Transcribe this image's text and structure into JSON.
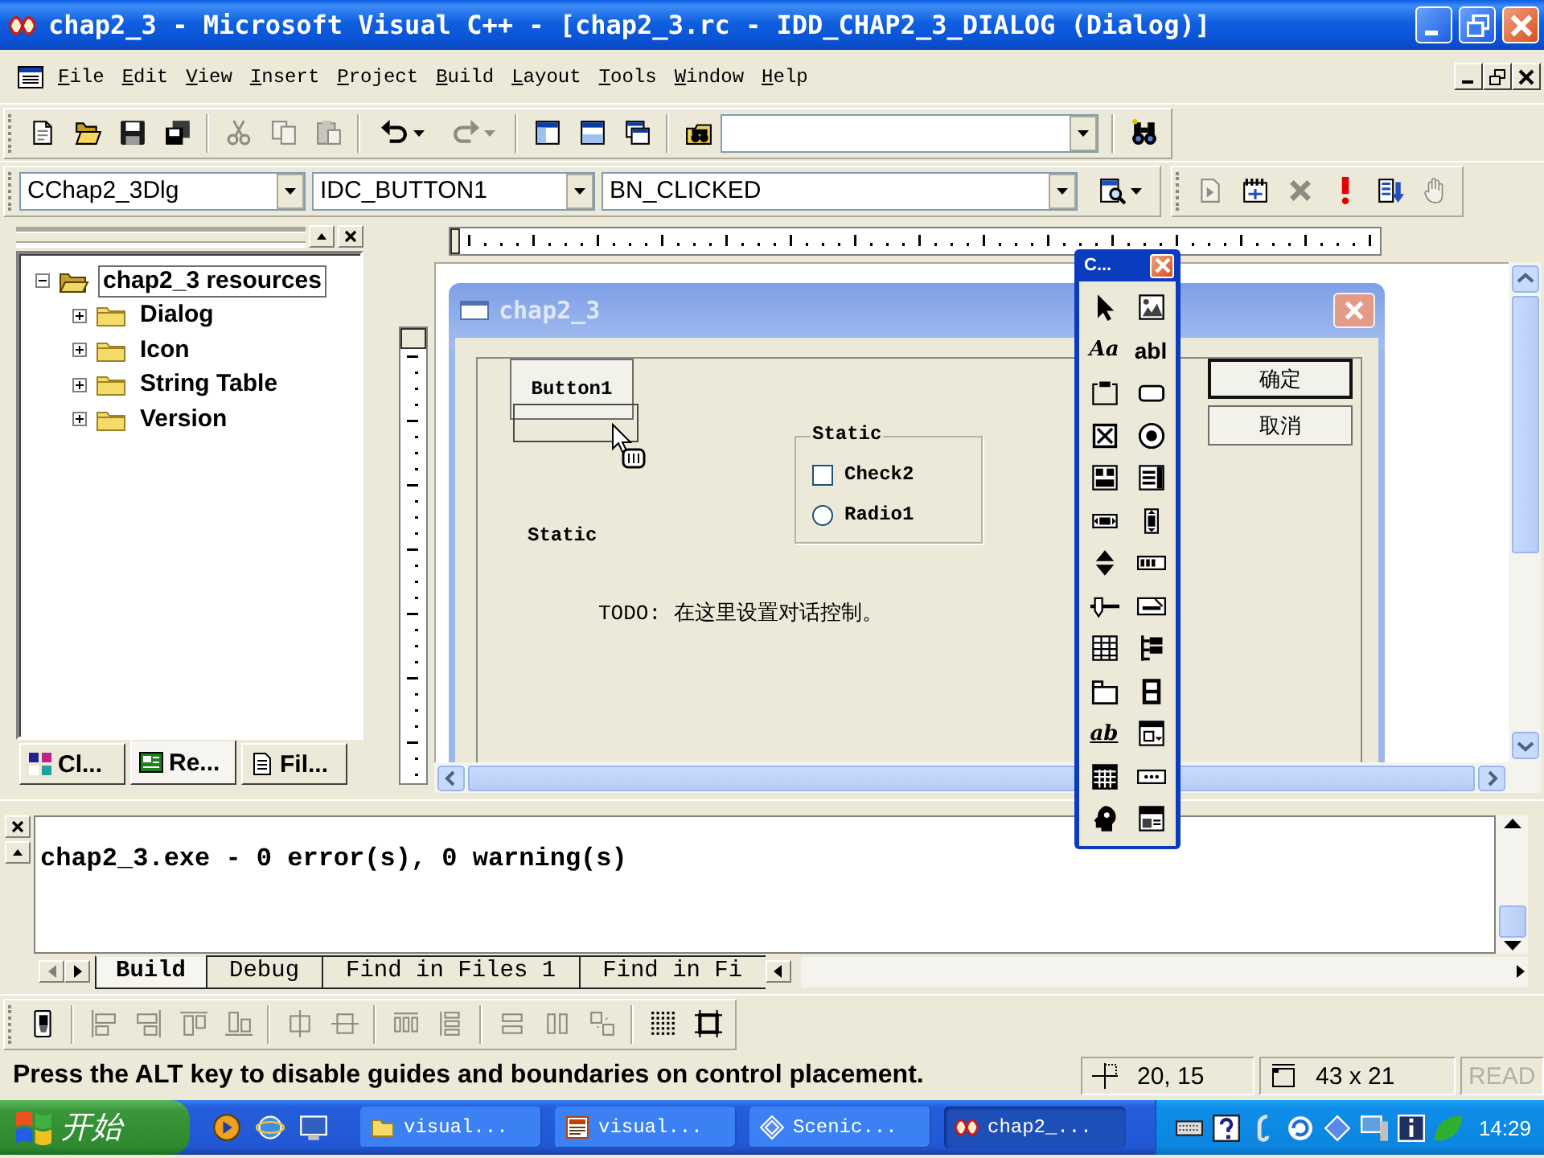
{
  "window": {
    "title": "chap2_3 - Microsoft Visual C++ - [chap2_3.rc - IDD_CHAP2_3_DIALOG (Dialog)]"
  },
  "menu_bar": {
    "items": [
      "File",
      "Edit",
      "View",
      "Insert",
      "Project",
      "Build",
      "Layout",
      "Tools",
      "Window",
      "Help"
    ]
  },
  "standard_toolbar": {
    "groups": [
      [
        {
          "kind": "new",
          "disabled": false
        },
        {
          "kind": "open",
          "disabled": false
        },
        {
          "kind": "save",
          "disabled": false
        },
        {
          "kind": "save_all",
          "disabled": false
        }
      ],
      [
        {
          "kind": "cut",
          "disabled": true
        },
        {
          "kind": "copy",
          "disabled": true
        },
        {
          "kind": "paste",
          "disabled": true
        }
      ],
      [
        {
          "kind": "undo",
          "disabled": false
        },
        {
          "kind": "redo",
          "disabled": true
        }
      ],
      [
        {
          "kind": "workspace",
          "disabled": false
        },
        {
          "kind": "output",
          "disabled": false
        },
        {
          "kind": "windows",
          "disabled": false
        }
      ],
      [
        {
          "kind": "find_in_files",
          "disabled": false
        },
        {
          "kind": "combo",
          "disabled": false
        }
      ],
      [
        {
          "kind": "find",
          "disabled": false
        }
      ]
    ]
  },
  "wizard_bar": {
    "class_combo": "CChap2_3Dlg",
    "filter_combo": "IDC_BUTTON1",
    "member_combo": "BN_CLICKED",
    "buttons": [
      {
        "kind": "wizard_action",
        "disabled": false
      }
    ]
  },
  "build_toolbar": {
    "buttons": [
      {
        "kind": "compile",
        "disabled": true
      },
      {
        "kind": "build",
        "disabled": false
      },
      {
        "kind": "stop_build",
        "disabled": true
      },
      {
        "kind": "execute",
        "disabled": false
      },
      {
        "kind": "go",
        "disabled": false
      },
      {
        "kind": "breakpoint",
        "disabled": true
      }
    ]
  },
  "workspace": {
    "tree": [
      {
        "label": "chap2_3 resources",
        "expanded": true,
        "selected": true,
        "children": [
          {
            "label": "Dialog",
            "expanded": false,
            "selected": false
          },
          {
            "label": "Icon",
            "expanded": false,
            "selected": false
          },
          {
            "label": "String Table",
            "expanded": false,
            "selected": false
          },
          {
            "label": "Version",
            "expanded": false,
            "selected": false
          }
        ]
      }
    ],
    "tabs": [
      {
        "label": "Cl...",
        "selected": false
      },
      {
        "label": "Re...",
        "selected": true
      },
      {
        "label": "Fil...",
        "selected": false
      }
    ]
  },
  "dialog_editor": {
    "dialog": {
      "title": "chap2_3",
      "controls": [
        {
          "kind": "button",
          "label": "Button1",
          "default": false,
          "selected": true
        },
        {
          "kind": "group_box",
          "label": "Static",
          "selected": false
        },
        {
          "kind": "check_box",
          "label": "Check2",
          "checked": false,
          "selected": false
        },
        {
          "kind": "radio",
          "label": "Radio1",
          "checked": false,
          "selected": false
        },
        {
          "kind": "static",
          "label": "Static",
          "selected": false
        },
        {
          "kind": "static",
          "label": "TODO: 在这里设置对话控制。",
          "selected": false
        },
        {
          "kind": "button",
          "label": "确定",
          "default": true,
          "selected": false
        },
        {
          "kind": "button",
          "label": "取消",
          "default": false,
          "selected": false
        }
      ]
    }
  },
  "controls_toolbox": {
    "title": "C...",
    "tools": [
      {
        "kind": "pointer"
      },
      {
        "kind": "picture"
      },
      {
        "kind": "static_text",
        "glyph": "Aa"
      },
      {
        "kind": "edit",
        "glyph": "abl"
      },
      {
        "kind": "group_box"
      },
      {
        "kind": "button"
      },
      {
        "kind": "check_box"
      },
      {
        "kind": "radio"
      },
      {
        "kind": "combo_box"
      },
      {
        "kind": "list_box"
      },
      {
        "kind": "h_scroll"
      },
      {
        "kind": "v_scroll"
      },
      {
        "kind": "spin"
      },
      {
        "kind": "progress"
      },
      {
        "kind": "slider"
      },
      {
        "kind": "hotkey"
      },
      {
        "kind": "list_control"
      },
      {
        "kind": "tree_control"
      },
      {
        "kind": "tab_control"
      },
      {
        "kind": "animate"
      },
      {
        "kind": "rich_edit",
        "glyph": "ab"
      },
      {
        "kind": "date_time"
      },
      {
        "kind": "month_calendar"
      },
      {
        "kind": "ip_address"
      },
      {
        "kind": "custom"
      },
      {
        "kind": "extended_combo"
      }
    ]
  },
  "output": {
    "lines": [
      "chap2_3.exe - 0 error(s), 0 warning(s)"
    ],
    "tabs": [
      {
        "label": "Build",
        "selected": true
      },
      {
        "label": "Debug",
        "selected": false
      },
      {
        "label": "Find in Files 1",
        "selected": false
      },
      {
        "label": "Find in Fi",
        "selected": false
      }
    ]
  },
  "dialog_toolbar": {
    "groups": [
      [
        {
          "kind": "test",
          "disabled": false
        }
      ],
      [
        {
          "kind": "align_left",
          "disabled": true
        },
        {
          "kind": "align_right",
          "disabled": true
        },
        {
          "kind": "align_top",
          "disabled": true
        },
        {
          "kind": "align_bottom",
          "disabled": true
        }
      ],
      [
        {
          "kind": "center_vertical",
          "disabled": true
        },
        {
          "kind": "center_horizontal",
          "disabled": true
        }
      ],
      [
        {
          "kind": "space_across",
          "disabled": true
        },
        {
          "kind": "space_down",
          "disabled": true
        }
      ],
      [
        {
          "kind": "same_width",
          "disabled": true
        },
        {
          "kind": "same_height",
          "disabled": true
        },
        {
          "kind": "same_size",
          "disabled": true
        }
      ],
      [
        {
          "kind": "grid",
          "disabled": false
        },
        {
          "kind": "guides",
          "disabled": false
        }
      ]
    ]
  },
  "status_bar": {
    "message": "Press the ALT key to disable guides and boundaries on control placement.",
    "position": "20, 15",
    "size": "43 x 21",
    "indicators": [
      {
        "label": "READ",
        "on": false
      }
    ]
  },
  "taskbar": {
    "start": "开始",
    "tasks": [
      {
        "kind": "folder",
        "label": "visual...",
        "selected": false
      },
      {
        "kind": "document",
        "label": "visual...",
        "selected": false
      },
      {
        "kind": "diamond",
        "label": "Scenic...",
        "selected": false
      },
      {
        "kind": "app",
        "label": "chap2_...",
        "selected": true
      }
    ],
    "clock": "14:29"
  }
}
